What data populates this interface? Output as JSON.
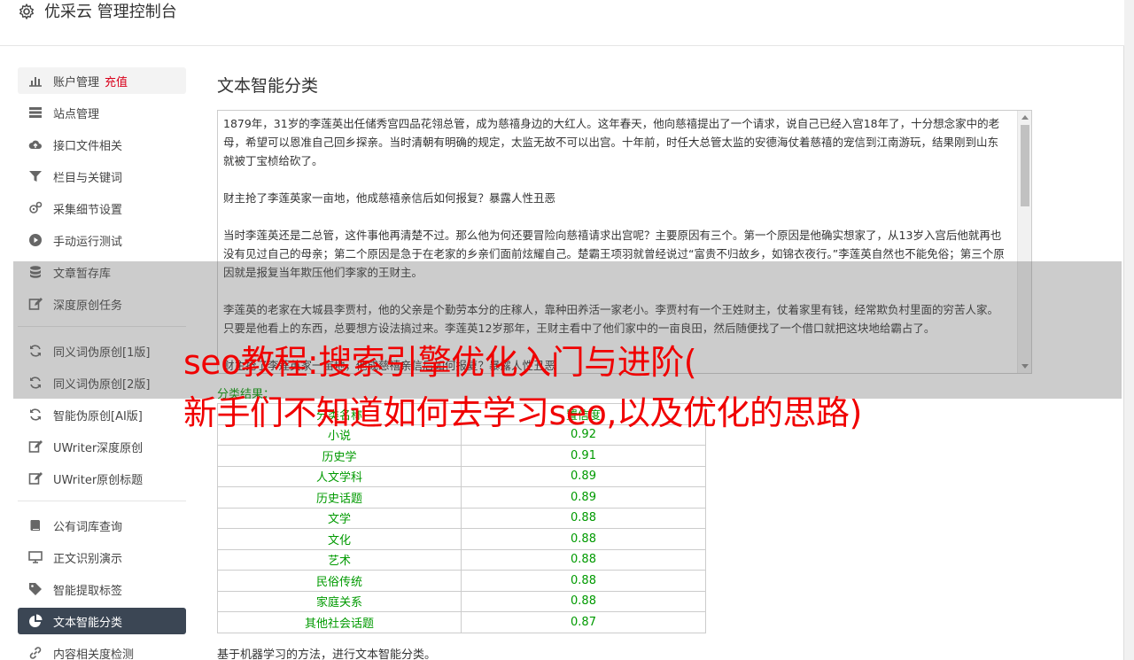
{
  "header": {
    "title": "优采云 管理控制台"
  },
  "sidebar": {
    "recharge": "充值",
    "groups": [
      [
        {
          "label": "账户管理",
          "icon": "bar-chart-icon",
          "name": "sidebar-item-account"
        },
        {
          "label": "站点管理",
          "icon": "server-icon",
          "name": "sidebar-item-sites"
        },
        {
          "label": "接口文件相关",
          "icon": "cloud-upload-icon",
          "name": "sidebar-item-api-files"
        },
        {
          "label": "栏目与关键词",
          "icon": "filter-icon",
          "name": "sidebar-item-columns-keywords"
        },
        {
          "label": "采集细节设置",
          "icon": "gears-icon",
          "name": "sidebar-item-collect-settings"
        },
        {
          "label": "手动运行测试",
          "icon": "play-circle-icon",
          "name": "sidebar-item-manual-run"
        },
        {
          "label": "文章暂存库",
          "icon": "database-icon",
          "name": "sidebar-item-article-store"
        },
        {
          "label": "深度原创任务",
          "icon": "edit-icon",
          "name": "sidebar-item-deep-original"
        }
      ],
      [
        {
          "label": "同义词伪原创[1版]",
          "icon": "refresh-icon",
          "name": "sidebar-item-synonym-v1"
        },
        {
          "label": "同义词伪原创[2版]",
          "icon": "refresh-icon",
          "name": "sidebar-item-synonym-v2"
        },
        {
          "label": "智能伪原创[AI版]",
          "icon": "refresh-icon",
          "name": "sidebar-item-ai-rewrite"
        },
        {
          "label": "UWriter深度原创",
          "icon": "edit-icon",
          "name": "sidebar-item-uwriter-deep"
        },
        {
          "label": "UWriter原创标题",
          "icon": "edit-icon",
          "name": "sidebar-item-uwriter-title"
        }
      ],
      [
        {
          "label": "公有词库查询",
          "icon": "book-icon",
          "name": "sidebar-item-public-lexicon"
        },
        {
          "label": "正文识别演示",
          "icon": "monitor-icon",
          "name": "sidebar-item-text-recognition"
        },
        {
          "label": "智能提取标签",
          "icon": "tag-icon",
          "name": "sidebar-item-tag-extract"
        },
        {
          "label": "文本智能分类",
          "icon": "pie-chart-icon",
          "name": "sidebar-item-text-classify",
          "active": true
        },
        {
          "label": "内容相关度检测",
          "icon": "link-icon",
          "name": "sidebar-item-relevance"
        }
      ]
    ]
  },
  "main": {
    "title": "文本智能分类",
    "text_paragraphs": [
      "1879年，31岁的李莲英出任储秀宫四品花翎总管，成为慈禧身边的大红人。这年春天，他向慈禧提出了一个请求，说自己已经入宫18年了，十分想念家中的老母，希望可以恩准自己回乡探亲。当时清朝有明确的规定，太监无故不可以出宫。十年前，时任大总管太监的安德海仗着慈禧的宠信到江南游玩，结果刚到山东就被丁宝桢给砍了。",
      "财主抢了李莲英家一亩地，他成慈禧亲信后如何报复？暴露人性丑恶",
      "当时李莲英还是二总管，这件事他再清楚不过。那么他为何还要冒险向慈禧请求出宫呢？主要原因有三个。第一个原因是他确实想家了，从13岁入宫后他就再也没有见过自己的母亲；第二个原因是急于在老家的乡亲们面前炫耀自己。楚霸王项羽就曾经说过“富贵不归故乡，如锦衣夜行。”李莲英自然也不能免俗；第三个原因就是报复当年欺压他们李家的王财主。",
      "李莲英的老家在大城县李贾村，他的父亲是个勤劳本分的庄稼人，靠种田养活一家老小。李贾村有一个王姓财主，仗着家里有钱，经常欺负村里面的穷苦人家。只要是他看上的东西，总要想方设法搞过来。李莲英12岁那年，王财主看中了他们家中的一亩良田，然后随便找了一个借口就把这块地给霸占了。",
      "财主抢了李莲英家一亩地，他成慈禧亲信后如何报复？暴露人性丑恶"
    ],
    "result_label": "分类结果：",
    "table": {
      "headers": [
        "分类名称",
        "置信度"
      ],
      "rows": [
        [
          "小说",
          "0.92"
        ],
        [
          "历史学",
          "0.91"
        ],
        [
          "人文学科",
          "0.89"
        ],
        [
          "历史话题",
          "0.89"
        ],
        [
          "文学",
          "0.88"
        ],
        [
          "文化",
          "0.88"
        ],
        [
          "艺术",
          "0.88"
        ],
        [
          "民俗传统",
          "0.88"
        ],
        [
          "家庭关系",
          "0.88"
        ],
        [
          "其他社会话题",
          "0.87"
        ]
      ]
    },
    "footer_note": "基于机器学习的方法，进行文本智能分类。"
  },
  "watermark": {
    "line1": "seo教程:搜索引擎优化入门与进阶(",
    "line2": "新手们不知道如何去学习seo,以及优化的思路)",
    "color": "#f00000"
  }
}
